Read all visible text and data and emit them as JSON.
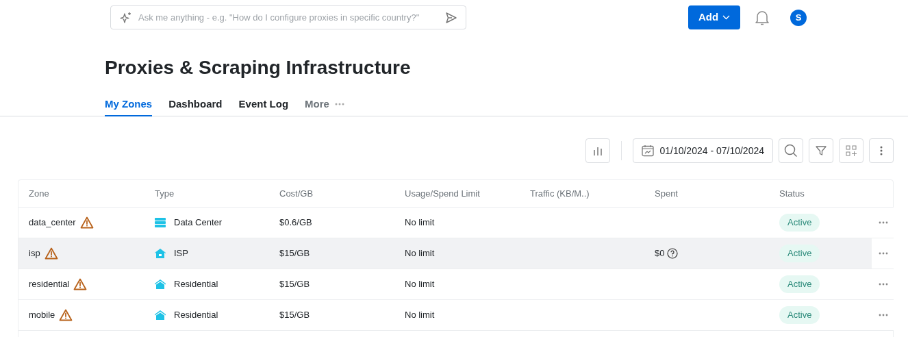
{
  "search": {
    "placeholder": "Ask me anything - e.g. \"How do I configure proxies in specific country?\""
  },
  "header": {
    "add_button": "Add",
    "avatar": "S"
  },
  "page_title": "Proxies & Scraping Infrastructure",
  "tabs": [
    {
      "label": "My Zones",
      "selected": true,
      "kind": "tab"
    },
    {
      "label": "Dashboard",
      "selected": false,
      "kind": "tab"
    },
    {
      "label": "Event Log",
      "selected": false,
      "kind": "tab"
    },
    {
      "label": "More",
      "selected": false,
      "kind": "menu"
    }
  ],
  "toolbar": {
    "date_range": "01/10/2024 - 07/10/2024"
  },
  "table": {
    "columns": [
      "Zone",
      "Type",
      "Cost/GB",
      "Usage/Spend Limit",
      "Traffic (KB/M..)",
      "Spent",
      "Status"
    ],
    "rows": [
      {
        "zone": "data_center",
        "warning": true,
        "type": "Data Center",
        "kind": "server",
        "cost": "$0.6/GB",
        "limit": "No limit",
        "spent_help": false,
        "status": "Active",
        "highlighted": false
      },
      {
        "zone": "isp",
        "warning": true,
        "type": "ISP",
        "kind": "isp",
        "cost": "$15/GB",
        "limit": "No limit",
        "spent": "$0",
        "spent_help": true,
        "status": "Active",
        "highlighted": true
      },
      {
        "zone": "residential",
        "warning": true,
        "type": "Residential",
        "kind": "house",
        "cost": "$15/GB",
        "limit": "No limit",
        "spent_help": false,
        "status": "Active",
        "highlighted": false
      },
      {
        "zone": "mobile",
        "warning": true,
        "type": "Residential",
        "kind": "house",
        "cost": "$15/GB",
        "limit": "No limit",
        "spent_help": false,
        "status": "Active",
        "highlighted": false
      }
    ]
  }
}
